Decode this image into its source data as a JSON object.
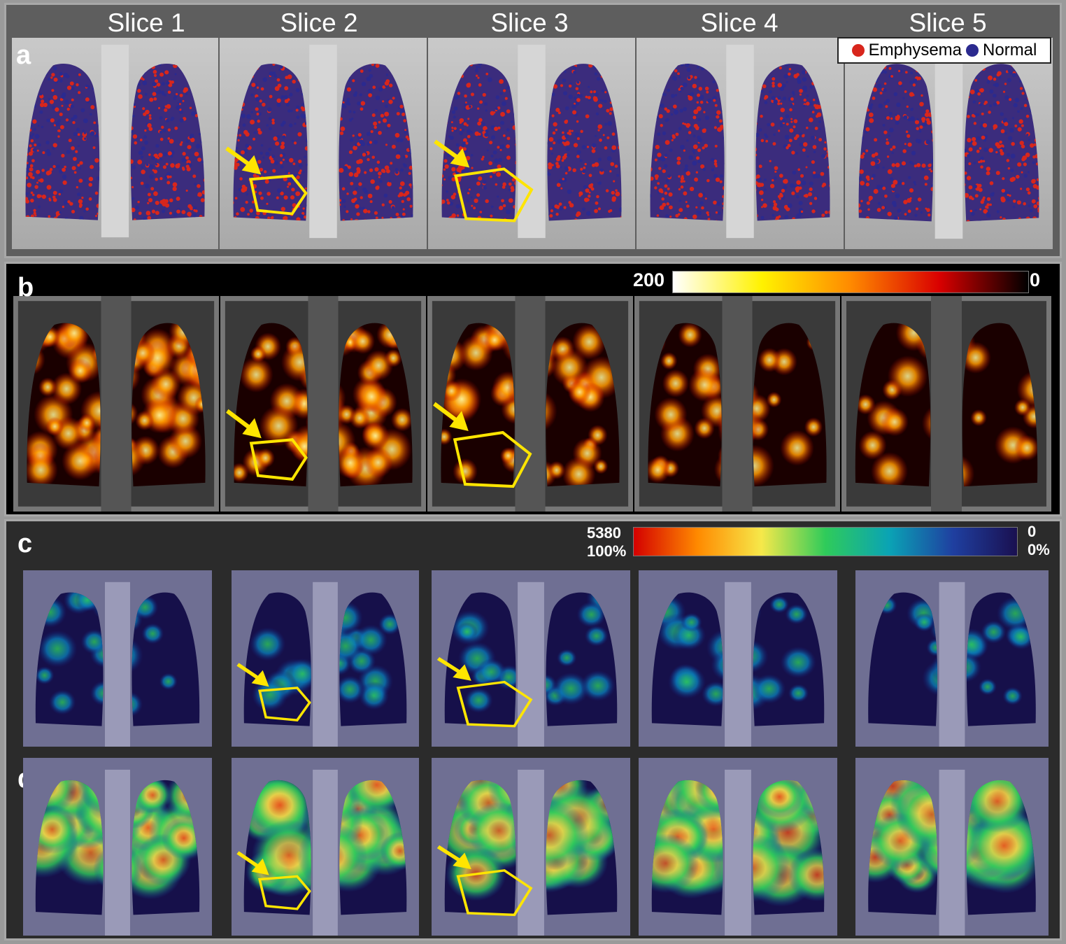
{
  "slices": [
    "Slice 1",
    "Slice 2",
    "Slice 3",
    "Slice 4",
    "Slice 5"
  ],
  "panels": {
    "a": "a",
    "b": "b",
    "c": "c",
    "d": "d"
  },
  "legend_a": {
    "emphysema": "Emphysema",
    "normal": "Normal",
    "emphysema_color": "#d8261c",
    "normal_color": "#2b2a8f"
  },
  "colorbar_b": {
    "max_label": "200",
    "min_label": "0",
    "colors": [
      "#ffffff",
      "#fff200",
      "#ff8a00",
      "#d90000",
      "#000000"
    ]
  },
  "colorbar_c": {
    "max_label": "5380",
    "max_pct": "100%",
    "min_label": "0",
    "min_pct": "0%",
    "colors": [
      "#d40000",
      "#ff8a00",
      "#f6e84a",
      "#2fcb5a",
      "#0aa3b5",
      "#1f3fa0",
      "#1a1050"
    ]
  },
  "accent": {
    "roi_outline": "#ffe500",
    "arrow": "#ffe500"
  }
}
